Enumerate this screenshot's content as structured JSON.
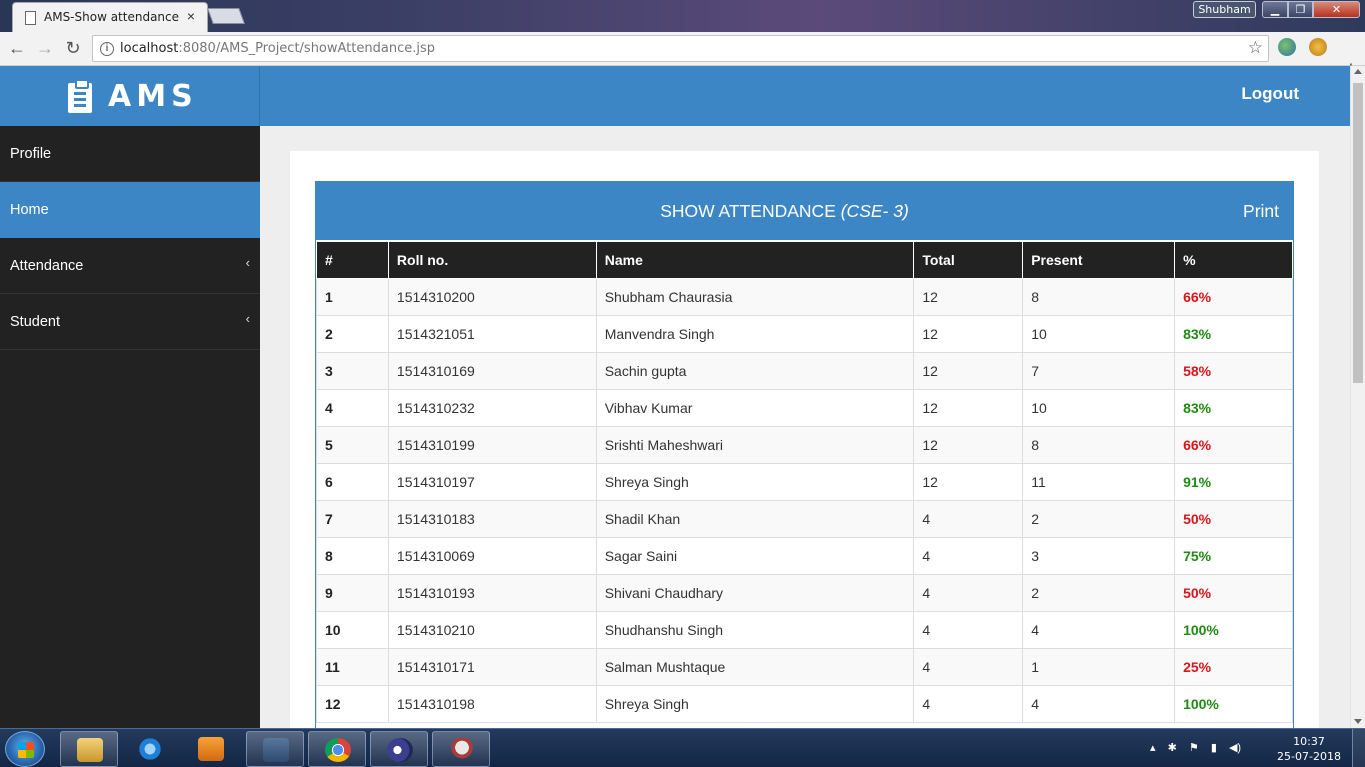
{
  "browser": {
    "tab_title": "AMS-Show attendance",
    "tab_close": "×",
    "url_host": "localhost",
    "url_rest": ":8080/AMS_Project/showAttendance.jsp",
    "user_name": "Shubham",
    "win_min": "▁",
    "win_max": "❐",
    "win_close": "✕",
    "back": "←",
    "forward": "→",
    "reload": "↻",
    "star": "☆",
    "menu": "⋮"
  },
  "app": {
    "brand": "AMS",
    "logout": "Logout",
    "sidebar": [
      {
        "label": "Profile",
        "chevron": ""
      },
      {
        "label": "Home",
        "chevron": ""
      },
      {
        "label": "Attendance",
        "chevron": "‹"
      },
      {
        "label": "Student",
        "chevron": "‹"
      }
    ],
    "panel_title": "SHOW ATTENDANCE ",
    "panel_class": "(CSE- 3)",
    "print": "Print"
  },
  "table": {
    "headers": [
      "#",
      "Roll no.",
      "Name",
      "Total",
      "Present",
      "%"
    ],
    "rows": [
      {
        "n": "1",
        "roll": "1514310200",
        "name": "Shubham Chaurasia",
        "total": "12",
        "present": "8",
        "pct": "66%",
        "status": "low"
      },
      {
        "n": "2",
        "roll": "1514321051",
        "name": "Manvendra Singh",
        "total": "12",
        "present": "10",
        "pct": "83%",
        "status": "good"
      },
      {
        "n": "3",
        "roll": "1514310169",
        "name": "Sachin gupta",
        "total": "12",
        "present": "7",
        "pct": "58%",
        "status": "low"
      },
      {
        "n": "4",
        "roll": "1514310232",
        "name": "Vibhav Kumar",
        "total": "12",
        "present": "10",
        "pct": "83%",
        "status": "good"
      },
      {
        "n": "5",
        "roll": "1514310199",
        "name": "Srishti Maheshwari",
        "total": "12",
        "present": "8",
        "pct": "66%",
        "status": "low"
      },
      {
        "n": "6",
        "roll": "1514310197",
        "name": "Shreya Singh",
        "total": "12",
        "present": "11",
        "pct": "91%",
        "status": "good"
      },
      {
        "n": "7",
        "roll": "1514310183",
        "name": "Shadil Khan",
        "total": "4",
        "present": "2",
        "pct": "50%",
        "status": "low"
      },
      {
        "n": "8",
        "roll": "1514310069",
        "name": "Sagar Saini",
        "total": "4",
        "present": "3",
        "pct": "75%",
        "status": "good"
      },
      {
        "n": "9",
        "roll": "1514310193",
        "name": "Shivani Chaudhary",
        "total": "4",
        "present": "2",
        "pct": "50%",
        "status": "low"
      },
      {
        "n": "10",
        "roll": "1514310210",
        "name": "Shudhanshu Singh",
        "total": "4",
        "present": "4",
        "pct": "100%",
        "status": "good"
      },
      {
        "n": "11",
        "roll": "1514310171",
        "name": "Salman Mushtaque",
        "total": "4",
        "present": "1",
        "pct": "25%",
        "status": "low"
      },
      {
        "n": "12",
        "roll": "1514310198",
        "name": "Shreya Singh",
        "total": "4",
        "present": "4",
        "pct": "100%",
        "status": "good"
      }
    ]
  },
  "colors": {
    "primary": "#3d86c6",
    "sidebar_bg": "#222222",
    "low_pct": "#d9141a",
    "good_pct": "#1f8a12"
  },
  "taskbar": {
    "time": "10:37",
    "date": "25-07-2018",
    "apps": [
      "folder-icon",
      "ie-icon",
      "media-player-icon",
      "mysql-workbench-icon",
      "chrome-icon",
      "eclipse-icon",
      "gimp-icon"
    ]
  }
}
